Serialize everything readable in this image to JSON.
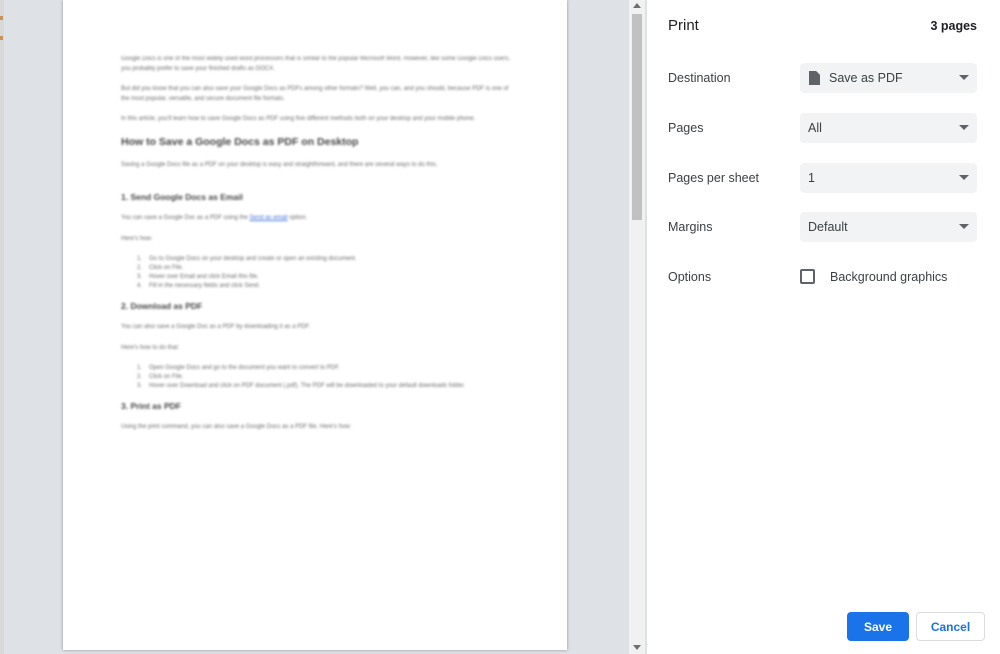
{
  "dialog": {
    "title": "Print",
    "page_count": "3 pages",
    "destination": {
      "label": "Destination",
      "value": "Save as PDF"
    },
    "pages": {
      "label": "Pages",
      "value": "All"
    },
    "pages_per_sheet": {
      "label": "Pages per sheet",
      "value": "1"
    },
    "margins": {
      "label": "Margins",
      "value": "Default"
    },
    "options": {
      "label": "Options",
      "background_graphics": "Background graphics",
      "background_graphics_checked": false
    },
    "save_label": "Save",
    "cancel_label": "Cancel",
    "accent_color": "#1a73e8"
  },
  "document": {
    "paragraphs": [
      "Google Docs is one of the most widely used word processors that is similar to the popular Microsoft Word. However, like some Google Docs users, you probably prefer to save your finished drafts as DOCX.",
      "But did you know that you can also save your Google Docs as PDFs among other formats? Well, you can, and you should, because PDF is one of the most popular, versatile, and secure document file formats.",
      "In this article, you'll learn how to save Google Docs as PDF using five different methods both on your desktop and your mobile phone."
    ],
    "heading": "How to Save a Google Docs as PDF on Desktop",
    "intro": "Saving a Google Docs file as a PDF on your desktop is easy and straightforward, and there are several ways to do this.",
    "section1": {
      "title": "1. Send Google Docs as Email",
      "text_before": "You can save a Google Doc as a PDF using the ",
      "link": "Send as email",
      "text_after": " option.",
      "howto": "Here's how:",
      "steps": [
        "Go to Google Docs on your desktop and create or open an existing document.",
        "Click on File.",
        "Hover over Email and click Email this file.",
        "Fill in the necessary fields and click Send."
      ]
    },
    "section2": {
      "title": "2. Download as PDF",
      "text": "You can also save a Google Doc as a PDF by downloading it as a PDF.",
      "howto": "Here's how to do that:",
      "steps": [
        "Open Google Docs and go to the document you want to convert to PDF.",
        "Click on File.",
        "Hover over Download and click on PDF document (.pdf). The PDF will be downloaded to your default downloads folder."
      ]
    },
    "section3": {
      "title": "3. Print as PDF",
      "text": "Using the print command, you can also save a Google Docs as a PDF file. Here's how:"
    }
  }
}
